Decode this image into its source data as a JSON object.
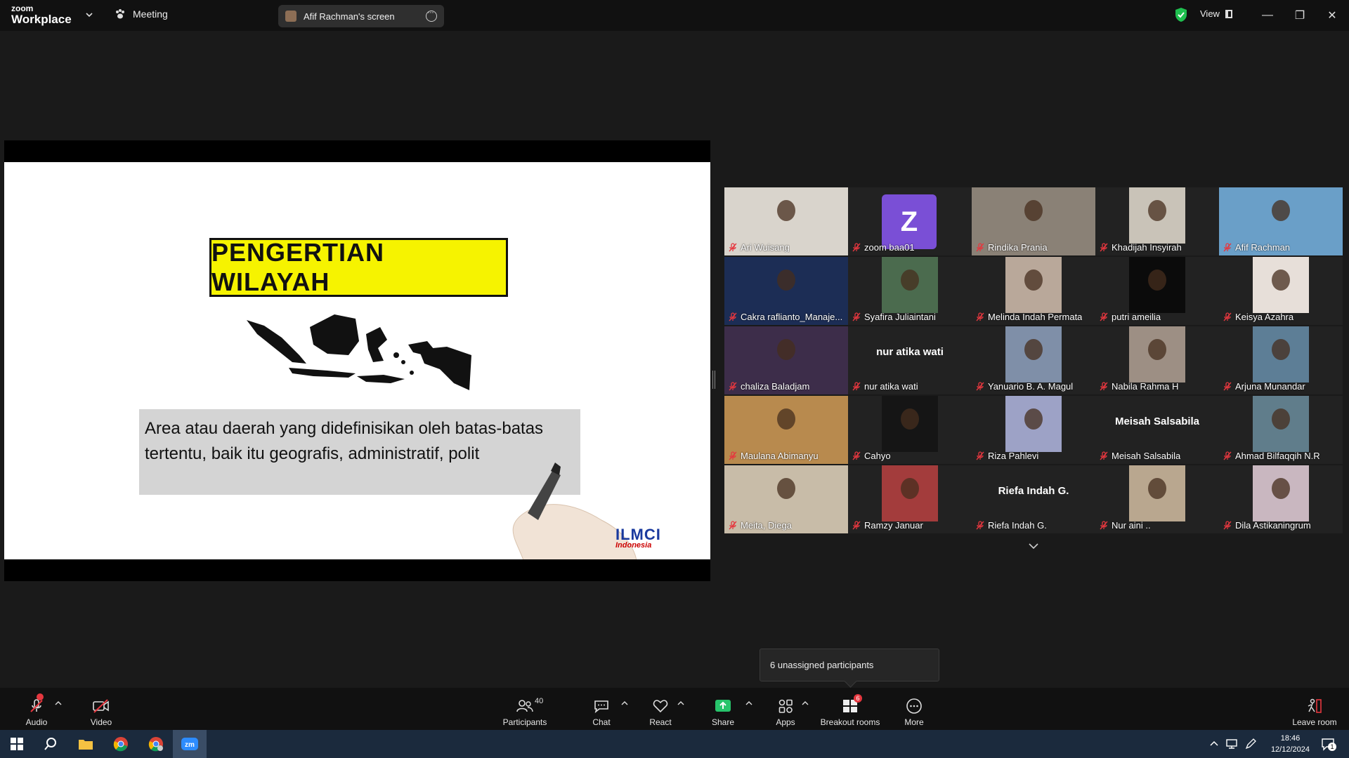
{
  "app": {
    "brand_top": "zoom",
    "brand_bottom": "Workplace"
  },
  "titlebar": {
    "meeting_label": "Meeting",
    "screen_share_label": "Afif Rachman's screen",
    "view_label": "View",
    "icons": [
      "chevron-down-icon",
      "paw-icon",
      "more-icon",
      "shield-check-icon",
      "minimize-icon",
      "restore-icon",
      "close-icon"
    ],
    "colors": {
      "shield": "#1fbf4f"
    }
  },
  "slide": {
    "title": "PENGERTIAN WILAYAH",
    "text_line1": "Area atau daerah yang didefinisikan oleh batas-batas",
    "text_line2": "tertentu, baik itu geografis, administratif, polit",
    "logo": "ILMCI",
    "logo_suffix": "Indonesia",
    "colors": {
      "title_bg": "#f6f300",
      "text_bg": "#d4d4d4"
    }
  },
  "participants": [
    {
      "name": "Ari Wuisang",
      "muted": true,
      "video": true
    },
    {
      "name": "zoom baa01",
      "muted": true,
      "avatar_letter": "Z"
    },
    {
      "name": "Rindika Prania",
      "muted": true,
      "video": true
    },
    {
      "name": "Khadijah Insyirah",
      "muted": true,
      "video": true
    },
    {
      "name": "Afif Rachman",
      "muted": true,
      "video": true,
      "active_speaker": true
    },
    {
      "name": "Cakra raflianto_Manaje...",
      "muted": true,
      "video": true
    },
    {
      "name": "Syafira Juliaintani",
      "muted": true,
      "video": true
    },
    {
      "name": "Melinda Indah Permata",
      "muted": true,
      "video": true
    },
    {
      "name": "putri ameilia",
      "muted": true,
      "video": true
    },
    {
      "name": "Keisya Azahra",
      "muted": true,
      "video": true
    },
    {
      "name": "chaliza Baladjam",
      "muted": true,
      "video": true
    },
    {
      "name": "nur atika wati",
      "muted": true,
      "big_name": "nur atika wati"
    },
    {
      "name": "Yanuario B. A. Magul",
      "muted": true,
      "video": true
    },
    {
      "name": "Nabila Rahma H",
      "muted": true,
      "video": true
    },
    {
      "name": "Arjuna Munandar",
      "muted": true,
      "video": true
    },
    {
      "name": "Maulana Abimanyu",
      "muted": true,
      "video": true
    },
    {
      "name": "Cahyo",
      "muted": true,
      "video": true
    },
    {
      "name": "Riza Pahlevi",
      "muted": true,
      "video": true
    },
    {
      "name": "Meisah Salsabila",
      "muted": true,
      "big_name": "Meisah Salsabila"
    },
    {
      "name": "Ahmad Bilfaqqih N.R",
      "muted": true,
      "video": true
    },
    {
      "name": "Meita, Diega",
      "muted": true,
      "video": true
    },
    {
      "name": "Ramzy Januar",
      "muted": true,
      "video": true
    },
    {
      "name": "Riefa Indah G.",
      "muted": true,
      "big_name": "Riefa Indah G."
    },
    {
      "name": "Nur aini ..",
      "muted": true,
      "video": true
    },
    {
      "name": "Dila Astikaningrum",
      "muted": true,
      "video": true
    }
  ],
  "tooltip": {
    "text": "6 unassigned participants"
  },
  "toolbar": {
    "audio": "Audio",
    "video": "Video",
    "participants": "Participants",
    "participants_count": "40",
    "chat": "Chat",
    "react": "React",
    "share": "Share",
    "apps": "Apps",
    "breakout": "Breakout rooms",
    "breakout_badge": "6",
    "more": "More",
    "leave": "Leave room",
    "colors": {
      "share": "#27c46b",
      "badge": "#e5373f",
      "leave": "#e5373f"
    }
  },
  "taskbar": {
    "time": "18:46",
    "date": "12/12/2024",
    "notification_count": "1",
    "icons": [
      "windows-start-icon",
      "search-icon",
      "file-explorer-icon",
      "chrome-icon",
      "chrome-profile-icon",
      "zoom-icon"
    ]
  }
}
